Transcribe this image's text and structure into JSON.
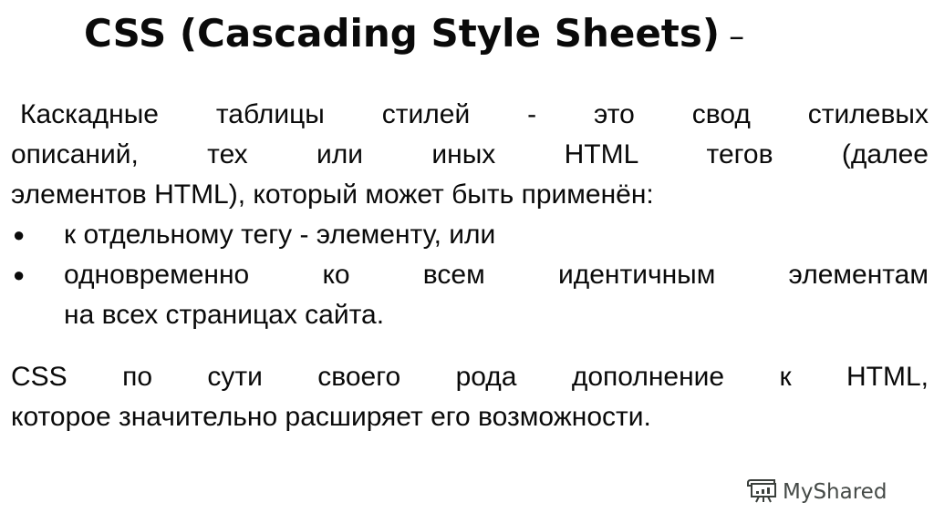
{
  "slide": {
    "title": "CSS (Cascading Style Sheets)",
    "title_dash": "–",
    "paragraph1": {
      "lines": [
        "Каскадные таблицы стилей - это свод стилевых",
        "описаний, тех или иных HTML тегов (далее",
        "элементов HTML), который может быть применён:"
      ]
    },
    "bullets": [
      {
        "icon": "bullet-dot",
        "lines": [
          "к отдельному тегу - элементу, или"
        ]
      },
      {
        "icon": "bullet-dot",
        "lines": [
          "одновременно ко всем идентичным элементам",
          "на всех страницах сайта."
        ]
      }
    ],
    "paragraph2": {
      "lines": [
        "CSS по сути своего рода дополнение к HTML,",
        "которое значительно расширяет его возможности."
      ]
    }
  },
  "watermark": {
    "icon": "presentation-board-icon",
    "text": "MyShared"
  }
}
